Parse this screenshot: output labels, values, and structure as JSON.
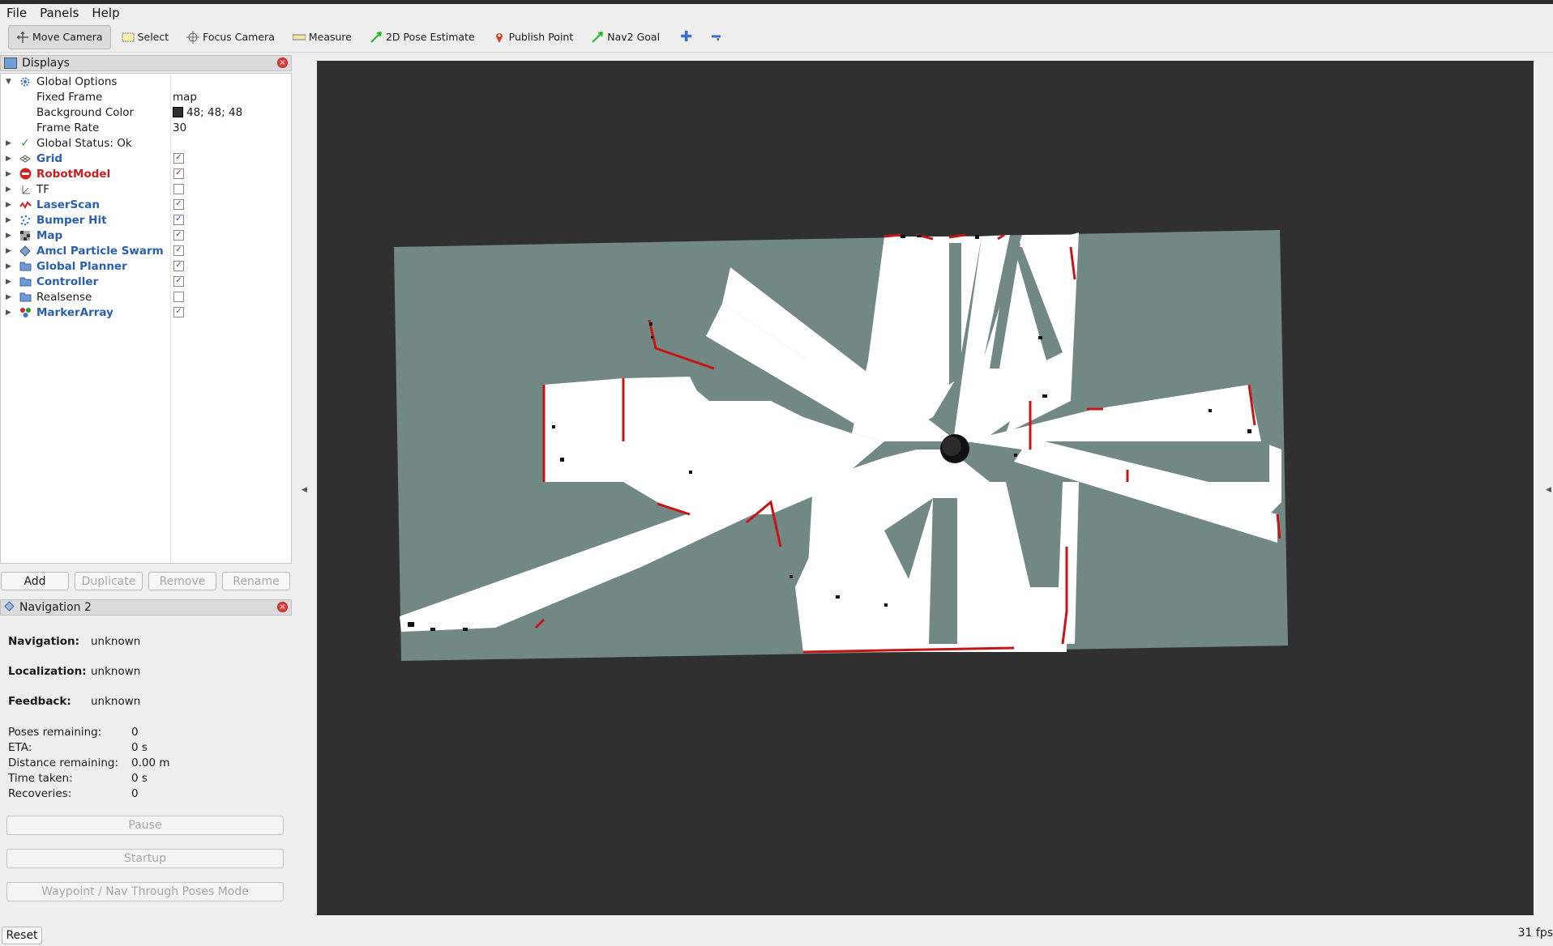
{
  "menu": [
    "File",
    "Panels",
    "Help"
  ],
  "toolbar": {
    "move_camera": "Move Camera",
    "select": "Select",
    "focus_camera": "Focus Camera",
    "measure": "Measure",
    "pose_estimate": "2D Pose Estimate",
    "publish_point": "Publish Point",
    "nav2_goal": "Nav2 Goal"
  },
  "displays": {
    "title": "Displays",
    "global_options": "Global Options",
    "fixed_frame_label": "Fixed Frame",
    "fixed_frame_value": "map",
    "bg_color_label": "Background Color",
    "bg_color_value": "48; 48; 48",
    "frame_rate_label": "Frame Rate",
    "frame_rate_value": "30",
    "global_status": "Global Status: Ok",
    "items": [
      {
        "label": "Grid",
        "checked": true
      },
      {
        "label": "RobotModel",
        "checked": true
      },
      {
        "label": "TF",
        "checked": false
      },
      {
        "label": "LaserScan",
        "checked": true
      },
      {
        "label": "Bumper Hit",
        "checked": true
      },
      {
        "label": "Map",
        "checked": true
      },
      {
        "label": "Amcl Particle Swarm",
        "checked": true
      },
      {
        "label": "Global Planner",
        "checked": true
      },
      {
        "label": "Controller",
        "checked": true
      },
      {
        "label": "Realsense",
        "checked": false
      },
      {
        "label": "MarkerArray",
        "checked": true
      }
    ],
    "buttons": {
      "add": "Add",
      "duplicate": "Duplicate",
      "remove": "Remove",
      "rename": "Rename"
    }
  },
  "nav": {
    "title": "Navigation 2",
    "navigation_label": "Navigation:",
    "navigation_value": "unknown",
    "localization_label": "Localization:",
    "localization_value": "unknown",
    "feedback_label": "Feedback:",
    "feedback_value": "unknown",
    "poses_label": "Poses remaining:",
    "poses_value": "0",
    "eta_label": "ETA:",
    "eta_value": "0 s",
    "distance_label": "Distance remaining:",
    "distance_value": "0.00 m",
    "time_label": "Time taken:",
    "time_value": "0 s",
    "recoveries_label": "Recoveries:",
    "recoveries_value": "0",
    "pause": "Pause",
    "startup": "Startup",
    "waypoint": "Waypoint / Nav Through Poses Mode"
  },
  "status": {
    "reset": "Reset",
    "fps": "31 fps"
  },
  "colors": {
    "background": "#303030",
    "map_unknown": "#728885",
    "map_free": "#ffffff",
    "laser": "#d01010"
  }
}
